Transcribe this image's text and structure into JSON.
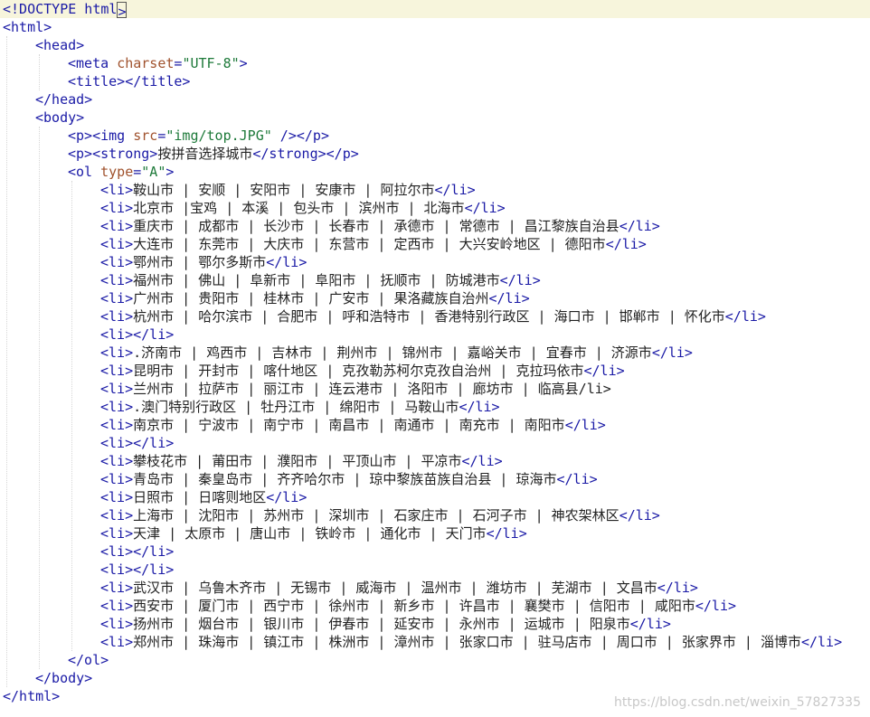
{
  "editor": {
    "lines": [
      {
        "indent": 0,
        "parts": [
          {
            "t": "<!DOCTYPE html",
            "c": "tag"
          },
          {
            "t": ">",
            "c": "cursor"
          }
        ]
      },
      {
        "indent": 0,
        "parts": [
          {
            "t": "<html>",
            "c": "tag"
          }
        ]
      },
      {
        "indent": 1,
        "parts": [
          {
            "t": "<head>",
            "c": "tag"
          }
        ]
      },
      {
        "indent": 2,
        "parts": [
          {
            "t": "<meta ",
            "c": "tag"
          },
          {
            "t": "charset",
            "c": "attr"
          },
          {
            "t": "=",
            "c": "tag"
          },
          {
            "t": "\"UTF-8\"",
            "c": "val"
          },
          {
            "t": ">",
            "c": "tag"
          }
        ]
      },
      {
        "indent": 2,
        "parts": [
          {
            "t": "<title></title>",
            "c": "tag"
          }
        ]
      },
      {
        "indent": 1,
        "parts": [
          {
            "t": "</head>",
            "c": "tag"
          }
        ]
      },
      {
        "indent": 1,
        "parts": [
          {
            "t": "<body>",
            "c": "tag"
          }
        ]
      },
      {
        "indent": 2,
        "parts": [
          {
            "t": "<p><img ",
            "c": "tag"
          },
          {
            "t": "src",
            "c": "attr"
          },
          {
            "t": "=",
            "c": "tag"
          },
          {
            "t": "\"img/top.JPG\"",
            "c": "val"
          },
          {
            "t": " /></p>",
            "c": "tag"
          }
        ]
      },
      {
        "indent": 2,
        "parts": [
          {
            "t": "<p><strong>",
            "c": "tag"
          },
          {
            "t": "按拼音选择城市",
            "c": "txt"
          },
          {
            "t": "</strong></p>",
            "c": "tag"
          }
        ]
      },
      {
        "indent": 2,
        "parts": [
          {
            "t": "<ol ",
            "c": "tag"
          },
          {
            "t": "type",
            "c": "attr"
          },
          {
            "t": "=",
            "c": "tag"
          },
          {
            "t": "\"A\"",
            "c": "val"
          },
          {
            "t": ">",
            "c": "tag"
          }
        ]
      },
      {
        "indent": 3,
        "parts": [
          {
            "t": "<li>",
            "c": "tag"
          },
          {
            "t": "鞍山市 | 安顺 | 安阳市 | 安康市 | 阿拉尔市",
            "c": "txt"
          },
          {
            "t": "</li>",
            "c": "tag"
          }
        ]
      },
      {
        "indent": 3,
        "parts": [
          {
            "t": "<li>",
            "c": "tag"
          },
          {
            "t": "北京市 |宝鸡 | 本溪 | 包头市 | 滨州市 | 北海市",
            "c": "txt"
          },
          {
            "t": "</li>",
            "c": "tag"
          }
        ]
      },
      {
        "indent": 3,
        "parts": [
          {
            "t": "<li>",
            "c": "tag"
          },
          {
            "t": "重庆市 | 成都市 | 长沙市 | 长春市 | 承德市 | 常德市 | 昌江黎族自治县",
            "c": "txt"
          },
          {
            "t": "</li>",
            "c": "tag"
          }
        ]
      },
      {
        "indent": 3,
        "parts": [
          {
            "t": "<li>",
            "c": "tag"
          },
          {
            "t": "大连市 | 东莞市 | 大庆市 | 东营市 | 定西市 | 大兴安岭地区 | 德阳市",
            "c": "txt"
          },
          {
            "t": "</li>",
            "c": "tag"
          }
        ]
      },
      {
        "indent": 3,
        "parts": [
          {
            "t": "<li>",
            "c": "tag"
          },
          {
            "t": "鄂州市 | 鄂尔多斯市",
            "c": "txt"
          },
          {
            "t": "</li>",
            "c": "tag"
          }
        ]
      },
      {
        "indent": 3,
        "parts": [
          {
            "t": "<li>",
            "c": "tag"
          },
          {
            "t": "福州市 | 佛山 | 阜新市 | 阜阳市 | 抚顺市 | 防城港市",
            "c": "txt"
          },
          {
            "t": "</li>",
            "c": "tag"
          }
        ]
      },
      {
        "indent": 3,
        "parts": [
          {
            "t": "<li>",
            "c": "tag"
          },
          {
            "t": "广州市 | 贵阳市 | 桂林市 | 广安市 | 果洛藏族自治州",
            "c": "txt"
          },
          {
            "t": "</li>",
            "c": "tag"
          }
        ]
      },
      {
        "indent": 3,
        "parts": [
          {
            "t": "<li>",
            "c": "tag"
          },
          {
            "t": "杭州市 | 哈尔滨市 | 合肥市 | 呼和浩特市 | 香港特别行政区 | 海口市 | 邯郸市 | 怀化市",
            "c": "txt"
          },
          {
            "t": "</li>",
            "c": "tag"
          }
        ]
      },
      {
        "indent": 3,
        "parts": [
          {
            "t": "<li></li>",
            "c": "tag"
          }
        ]
      },
      {
        "indent": 3,
        "parts": [
          {
            "t": "<li>",
            "c": "tag"
          },
          {
            "t": ".济南市 | 鸡西市 | 吉林市 | 荆州市 | 锦州市 | 嘉峪关市 | 宜春市 | 济源市",
            "c": "txt"
          },
          {
            "t": "</li>",
            "c": "tag"
          }
        ]
      },
      {
        "indent": 3,
        "parts": [
          {
            "t": "<li>",
            "c": "tag"
          },
          {
            "t": "昆明市 | 开封市 | 喀什地区 | 克孜勒苏柯尔克孜自治州 | 克拉玛依市",
            "c": "txt"
          },
          {
            "t": "</li>",
            "c": "tag"
          }
        ]
      },
      {
        "indent": 3,
        "parts": [
          {
            "t": "<li>",
            "c": "tag"
          },
          {
            "t": "兰州市 | 拉萨市 | 丽江市 | 连云港市 | 洛阳市 | 廊坊市 | 临高县/li>",
            "c": "txt"
          }
        ]
      },
      {
        "indent": 3,
        "parts": [
          {
            "t": "<li>",
            "c": "tag"
          },
          {
            "t": ".澳门特别行政区 | 牡丹江市 | 绵阳市 | 马鞍山市",
            "c": "txt"
          },
          {
            "t": "</li>",
            "c": "tag"
          }
        ]
      },
      {
        "indent": 3,
        "parts": [
          {
            "t": "<li>",
            "c": "tag"
          },
          {
            "t": "南京市 | 宁波市 | 南宁市 | 南昌市 | 南通市 | 南充市 | 南阳市",
            "c": "txt"
          },
          {
            "t": "</li>",
            "c": "tag"
          }
        ]
      },
      {
        "indent": 3,
        "parts": [
          {
            "t": "<li></li>",
            "c": "tag"
          }
        ]
      },
      {
        "indent": 3,
        "parts": [
          {
            "t": "<li>",
            "c": "tag"
          },
          {
            "t": "攀枝花市 | 莆田市 | 濮阳市 | 平顶山市 | 平凉市",
            "c": "txt"
          },
          {
            "t": "</li>",
            "c": "tag"
          }
        ]
      },
      {
        "indent": 3,
        "parts": [
          {
            "t": "<li>",
            "c": "tag"
          },
          {
            "t": "青岛市 | 秦皇岛市 | 齐齐哈尔市 | 琼中黎族苗族自治县 | 琼海市",
            "c": "txt"
          },
          {
            "t": "</li>",
            "c": "tag"
          }
        ]
      },
      {
        "indent": 3,
        "parts": [
          {
            "t": "<li>",
            "c": "tag"
          },
          {
            "t": "日照市 | 日喀则地区",
            "c": "txt"
          },
          {
            "t": "</li>",
            "c": "tag"
          }
        ]
      },
      {
        "indent": 3,
        "parts": [
          {
            "t": "<li>",
            "c": "tag"
          },
          {
            "t": "上海市 | 沈阳市 | 苏州市 | 深圳市 | 石家庄市 | 石河子市 | 神农架林区",
            "c": "txt"
          },
          {
            "t": "</li>",
            "c": "tag"
          }
        ]
      },
      {
        "indent": 3,
        "parts": [
          {
            "t": "<li>",
            "c": "tag"
          },
          {
            "t": "天津 | 太原市 | 唐山市 | 铁岭市 | 通化市 | 天门市",
            "c": "txt"
          },
          {
            "t": "</li>",
            "c": "tag"
          }
        ]
      },
      {
        "indent": 3,
        "parts": [
          {
            "t": "<li></li>",
            "c": "tag"
          }
        ]
      },
      {
        "indent": 3,
        "parts": [
          {
            "t": "<li></li>",
            "c": "tag"
          }
        ]
      },
      {
        "indent": 3,
        "parts": [
          {
            "t": "<li>",
            "c": "tag"
          },
          {
            "t": "武汉市 | 乌鲁木齐市 | 无锡市 | 威海市 | 温州市 | 潍坊市 | 芜湖市 | 文昌市",
            "c": "txt"
          },
          {
            "t": "</li>",
            "c": "tag"
          }
        ]
      },
      {
        "indent": 3,
        "parts": [
          {
            "t": "<li>",
            "c": "tag"
          },
          {
            "t": "西安市 | 厦门市 | 西宁市 | 徐州市 | 新乡市 | 许昌市 | 襄樊市 | 信阳市 | 咸阳市",
            "c": "txt"
          },
          {
            "t": "</li>",
            "c": "tag"
          }
        ]
      },
      {
        "indent": 3,
        "parts": [
          {
            "t": "<li>",
            "c": "tag"
          },
          {
            "t": "扬州市 | 烟台市 | 银川市 | 伊春市 | 延安市 | 永州市 | 运城市 | 阳泉市",
            "c": "txt"
          },
          {
            "t": "</li>",
            "c": "tag"
          }
        ]
      },
      {
        "indent": 3,
        "parts": [
          {
            "t": "<li>",
            "c": "tag"
          },
          {
            "t": "郑州市 | 珠海市 | 镇江市 | 株洲市 | 漳州市 | 张家口市 | 驻马店市 | 周口市 | 张家界市 | 淄博市",
            "c": "txt"
          },
          {
            "t": "</li>",
            "c": "tag"
          }
        ]
      },
      {
        "indent": 2,
        "parts": [
          {
            "t": "</ol>",
            "c": "tag"
          }
        ]
      },
      {
        "indent": 1,
        "parts": [
          {
            "t": "</body>",
            "c": "tag"
          }
        ]
      },
      {
        "indent": 0,
        "parts": [
          {
            "t": "</html>",
            "c": "tag"
          }
        ]
      }
    ]
  },
  "watermark": "https://blog.csdn.net/weixin_57827335"
}
